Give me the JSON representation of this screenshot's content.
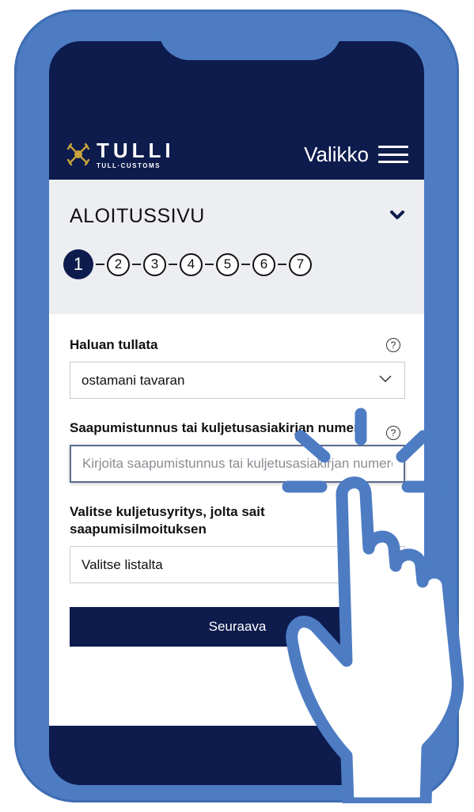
{
  "header": {
    "logo_main": "TULLI",
    "logo_sub": "TULL·CUSTOMS",
    "menu_label": "Valikko"
  },
  "page": {
    "title": "ALOITUSSIVU",
    "steps": [
      "1",
      "2",
      "3",
      "4",
      "5",
      "6",
      "7"
    ],
    "active_step": 1
  },
  "form": {
    "clearance_label": "Haluan tullata",
    "clearance_value": "ostamani tavaran",
    "arrival_label": "Saapumistunnus tai kuljetusasiakirjan numero",
    "arrival_placeholder": "Kirjoita saapumistunnus tai kuljetusasiakirjan numero",
    "carrier_label": "Valitse kuljetusyritys, jolta sait saapumisilmoituksen",
    "carrier_value": "Valitse listalta",
    "next_label": "Seuraava",
    "help_symbol": "?"
  },
  "colors": {
    "frame": "#4d7cc3",
    "navy": "#0e1b4d",
    "panel": "#edeef2",
    "logo_gold": "#c9a43a"
  },
  "icons": [
    "hamburger-icon",
    "chevron-down-icon",
    "help-icon",
    "tap-hand-icon"
  ]
}
